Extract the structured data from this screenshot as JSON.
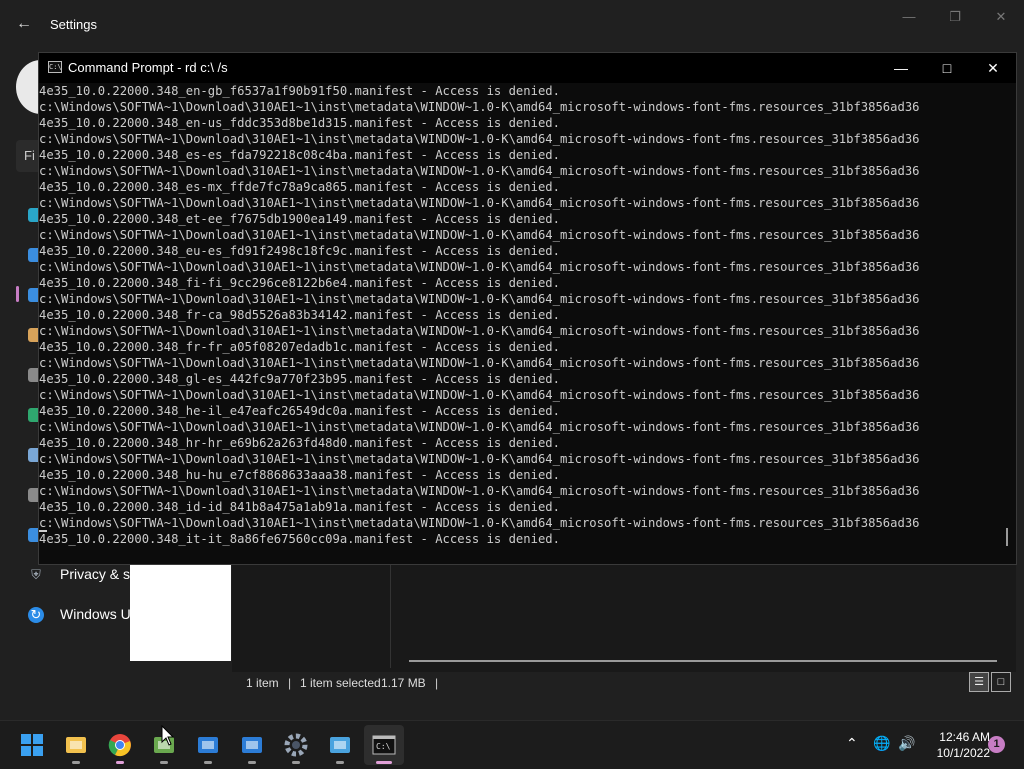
{
  "settings": {
    "title": "Settings",
    "search_partial": "Fi",
    "nav": [
      {
        "label": "Privacy & s",
        "icon": "shield-icon"
      },
      {
        "label": "Windows U",
        "icon": "windows-update-icon"
      }
    ]
  },
  "cmd": {
    "title": "Command Prompt - rd  c:\\ /s",
    "lines": [
      "4e35_10.0.22000.348_en-gb_f6537a1f90b91f50.manifest - Access is denied.",
      "c:\\Windows\\SOFTWA~1\\Download\\310AE1~1\\inst\\metadata\\WINDOW~1.0-K\\amd64_microsoft-windows-font-fms.resources_31bf3856ad36",
      "4e35_10.0.22000.348_en-us_fddc353d8be1d315.manifest - Access is denied.",
      "c:\\Windows\\SOFTWA~1\\Download\\310AE1~1\\inst\\metadata\\WINDOW~1.0-K\\amd64_microsoft-windows-font-fms.resources_31bf3856ad36",
      "4e35_10.0.22000.348_es-es_fda792218c08c4ba.manifest - Access is denied.",
      "c:\\Windows\\SOFTWA~1\\Download\\310AE1~1\\inst\\metadata\\WINDOW~1.0-K\\amd64_microsoft-windows-font-fms.resources_31bf3856ad36",
      "4e35_10.0.22000.348_es-mx_ffde7fc78a9ca865.manifest - Access is denied.",
      "c:\\Windows\\SOFTWA~1\\Download\\310AE1~1\\inst\\metadata\\WINDOW~1.0-K\\amd64_microsoft-windows-font-fms.resources_31bf3856ad36",
      "4e35_10.0.22000.348_et-ee_f7675db1900ea149.manifest - Access is denied.",
      "c:\\Windows\\SOFTWA~1\\Download\\310AE1~1\\inst\\metadata\\WINDOW~1.0-K\\amd64_microsoft-windows-font-fms.resources_31bf3856ad36",
      "4e35_10.0.22000.348_eu-es_fd91f2498c18fc9c.manifest - Access is denied.",
      "c:\\Windows\\SOFTWA~1\\Download\\310AE1~1\\inst\\metadata\\WINDOW~1.0-K\\amd64_microsoft-windows-font-fms.resources_31bf3856ad36",
      "4e35_10.0.22000.348_fi-fi_9cc296ce8122b6e4.manifest - Access is denied.",
      "c:\\Windows\\SOFTWA~1\\Download\\310AE1~1\\inst\\metadata\\WINDOW~1.0-K\\amd64_microsoft-windows-font-fms.resources_31bf3856ad36",
      "4e35_10.0.22000.348_fr-ca_98d5526a83b34142.manifest - Access is denied.",
      "c:\\Windows\\SOFTWA~1\\Download\\310AE1~1\\inst\\metadata\\WINDOW~1.0-K\\amd64_microsoft-windows-font-fms.resources_31bf3856ad36",
      "4e35_10.0.22000.348_fr-fr_a05f08207edadb1c.manifest - Access is denied.",
      "c:\\Windows\\SOFTWA~1\\Download\\310AE1~1\\inst\\metadata\\WINDOW~1.0-K\\amd64_microsoft-windows-font-fms.resources_31bf3856ad36",
      "4e35_10.0.22000.348_gl-es_442fc9a770f23b95.manifest - Access is denied.",
      "c:\\Windows\\SOFTWA~1\\Download\\310AE1~1\\inst\\metadata\\WINDOW~1.0-K\\amd64_microsoft-windows-font-fms.resources_31bf3856ad36",
      "4e35_10.0.22000.348_he-il_e47eafc26549dc0a.manifest - Access is denied.",
      "c:\\Windows\\SOFTWA~1\\Download\\310AE1~1\\inst\\metadata\\WINDOW~1.0-K\\amd64_microsoft-windows-font-fms.resources_31bf3856ad36",
      "4e35_10.0.22000.348_hr-hr_e69b62a263fd48d0.manifest - Access is denied.",
      "c:\\Windows\\SOFTWA~1\\Download\\310AE1~1\\inst\\metadata\\WINDOW~1.0-K\\amd64_microsoft-windows-font-fms.resources_31bf3856ad36",
      "4e35_10.0.22000.348_hu-hu_e7cf8868633aaa38.manifest - Access is denied.",
      "c:\\Windows\\SOFTWA~1\\Download\\310AE1~1\\inst\\metadata\\WINDOW~1.0-K\\amd64_microsoft-windows-font-fms.resources_31bf3856ad36",
      "4e35_10.0.22000.348_id-id_841b8a475a1ab91a.manifest - Access is denied.",
      "c:\\Windows\\SOFTWA~1\\Download\\310AE1~1\\inst\\metadata\\WINDOW~1.0-K\\amd64_microsoft-windows-font-fms.resources_31bf3856ad36",
      "4e35_10.0.22000.348_it-it_8a86fe67560cc09a.manifest - Access is denied."
    ]
  },
  "explorer": {
    "item_count": "1 item",
    "selected": "1 item selected",
    "size": "1.17 MB"
  },
  "taskbar": {
    "apps": [
      {
        "icon": "windows-start-icon",
        "color": "#3aa0f0"
      },
      {
        "icon": "file-explorer-icon",
        "color": "#f2c14e"
      },
      {
        "icon": "chrome-icon",
        "color": "#e8453c"
      },
      {
        "icon": "installer-icon",
        "color": "#6aa84f"
      },
      {
        "icon": "virtualbox-icon",
        "color": "#2c7cd6"
      },
      {
        "icon": "virtualbox-manager-icon",
        "color": "#2c7cd6"
      },
      {
        "icon": "settings-gear-icon",
        "color": "#9aa7b8"
      },
      {
        "icon": "control-panel-icon",
        "color": "#4aa3df"
      },
      {
        "icon": "terminal-icon",
        "color": "#cfcfcf"
      }
    ],
    "time": "12:46 AM",
    "date": "10/1/2022",
    "notification_count": "1"
  }
}
